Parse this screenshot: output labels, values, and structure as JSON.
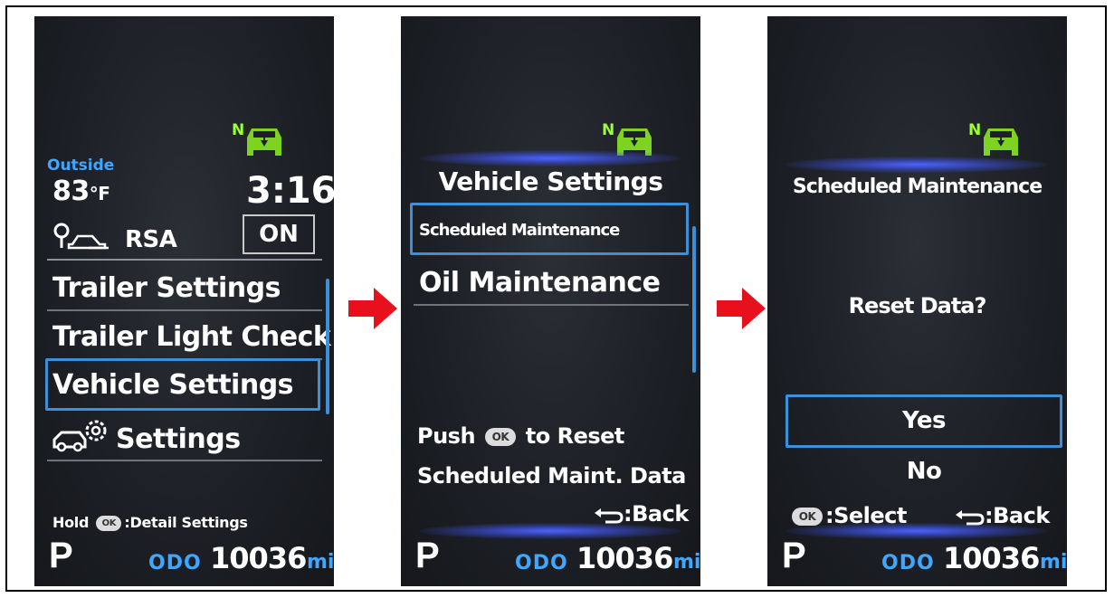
{
  "screens": [
    {
      "gear_indicator": "N",
      "outside_label": "Outside",
      "temperature": "83",
      "temperature_unit": "°F",
      "clock": "3:16",
      "rsa_label": "RSA",
      "rsa_state": "ON",
      "menu_items": [
        "Trailer Settings",
        "Trailer Light Check",
        "Vehicle Settings",
        "Settings"
      ],
      "selected_item": "Vehicle Settings",
      "hint_prefix": "Hold",
      "hint_ok": "OK",
      "hint_suffix": ":Detail Settings",
      "gear": "P",
      "odo_label": "ODO",
      "odometer": "10036",
      "odometer_unit": "mi"
    },
    {
      "gear_indicator": "N",
      "title": "Vehicle Settings",
      "menu_items": [
        "Scheduled Maintenance",
        "Oil Maintenance"
      ],
      "selected_item": "Scheduled Maintenance",
      "push_prefix": "Push",
      "push_ok": "OK",
      "push_suffix": "to Reset",
      "push_line2": "Scheduled Maint. Data",
      "back_label": ":Back",
      "gear": "P",
      "odo_label": "ODO",
      "odometer": "10036",
      "odometer_unit": "mi"
    },
    {
      "gear_indicator": "N",
      "title": "Scheduled Maintenance",
      "question": "Reset Data?",
      "options": [
        "Yes",
        "No"
      ],
      "selected_option": "Yes",
      "select_ok": "OK",
      "select_label": ":Select",
      "back_label": ":Back",
      "gear": "P",
      "odo_label": "ODO",
      "odometer": "10036",
      "odometer_unit": "mi"
    }
  ],
  "colors": {
    "accent_blue": "#3fa7ff",
    "selection_border": "#3d8fd8",
    "gear_indicator_green": "#9cff3a",
    "arrow_red": "#e8101c"
  },
  "icons": [
    "4wd-neutral-icon",
    "rsa-sign-car-icon",
    "car-gear-settings-icon",
    "back-arrow-icon",
    "ok-button-icon",
    "flow-arrow-icon"
  ]
}
